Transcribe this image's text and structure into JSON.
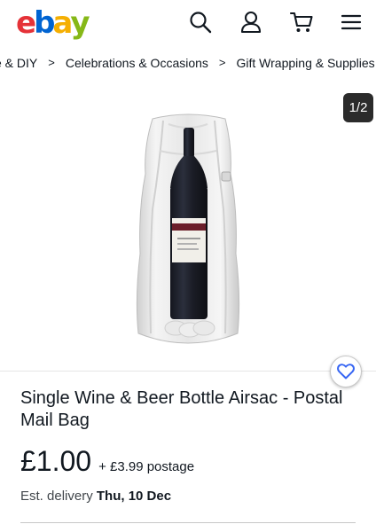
{
  "header": {
    "logo_letters": [
      {
        "char": "e",
        "color": "#e53238"
      },
      {
        "char": "b",
        "color": "#0064d2"
      },
      {
        "char": "a",
        "color": "#f5af02"
      },
      {
        "char": "y",
        "color": "#86b817"
      }
    ],
    "icons": [
      "search-icon",
      "user-icon",
      "cart-icon",
      "menu-icon"
    ]
  },
  "breadcrumb": {
    "items": [
      "e & DIY",
      "Celebrations & Occasions",
      "Gift Wrapping & Supplies"
    ],
    "separator": ">"
  },
  "gallery": {
    "counter": "1/2",
    "image_alt_icon": "wine-bottle-airsac-image"
  },
  "product": {
    "title": "Single Wine & Beer Bottle Airsac - Postal Mail Bag",
    "price": "£1.00",
    "postage": "+ £3.99 postage",
    "delivery_label": "Est. delivery",
    "delivery_date": "Thu, 10 Dec"
  },
  "colors": {
    "text": "#111820",
    "watch_icon": "#3665f3"
  }
}
